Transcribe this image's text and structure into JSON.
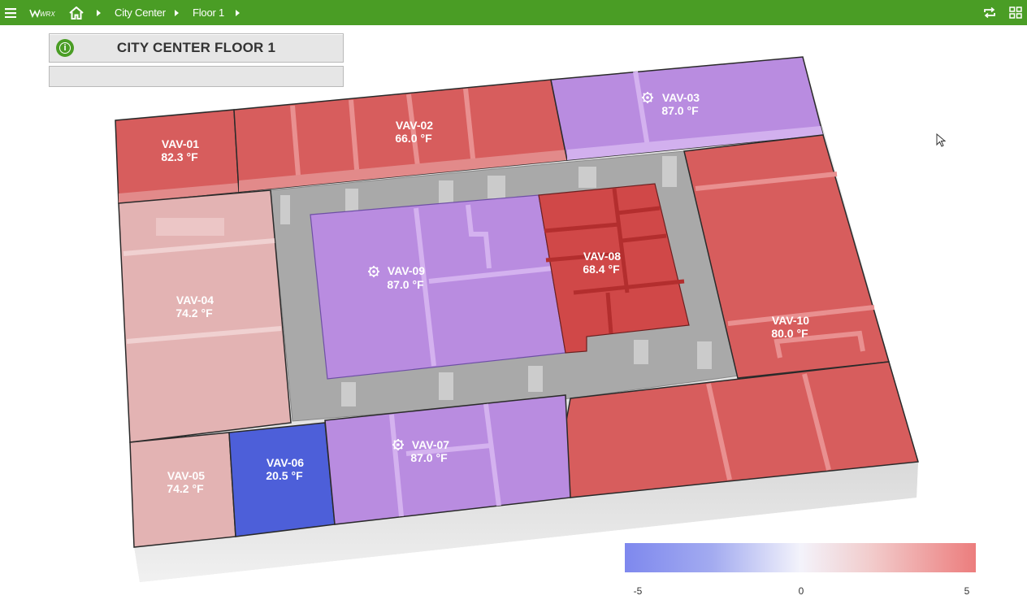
{
  "app": {
    "breadcrumb": [
      "City Center",
      "Floor 1"
    ],
    "colors": {
      "topbar": "#4a9d25"
    }
  },
  "header": {
    "title": "CITY CENTER FLOOR 1",
    "subtitle": ""
  },
  "zones": {
    "vav01": {
      "name": "VAV-01",
      "temp": "82.3 °F"
    },
    "vav02": {
      "name": "VAV-02",
      "temp": "66.0 °F"
    },
    "vav03": {
      "name": "VAV-03",
      "temp": "87.0 °F"
    },
    "vav04": {
      "name": "VAV-04",
      "temp": "74.2 °F"
    },
    "vav05": {
      "name": "VAV-05",
      "temp": "74.2 °F"
    },
    "vav06": {
      "name": "VAV-06",
      "temp": "20.5 °F"
    },
    "vav07": {
      "name": "VAV-07",
      "temp": "87.0 °F"
    },
    "vav08": {
      "name": "VAV-08",
      "temp": "68.4 °F"
    },
    "vav09": {
      "name": "VAV-09",
      "temp": "87.0 °F"
    },
    "vav10": {
      "name": "VAV-10",
      "temp": "80.0 °F"
    }
  },
  "legend": {
    "min": "-5",
    "mid": "0",
    "max": "5",
    "colors": {
      "low": "#7e88ee",
      "neutral": "#f3f3fb",
      "high": "#ec7d7d"
    }
  },
  "icons": [
    "menu-icon",
    "logo-icon",
    "home-icon",
    "refresh-icon",
    "grid-icon",
    "gear-icon"
  ]
}
